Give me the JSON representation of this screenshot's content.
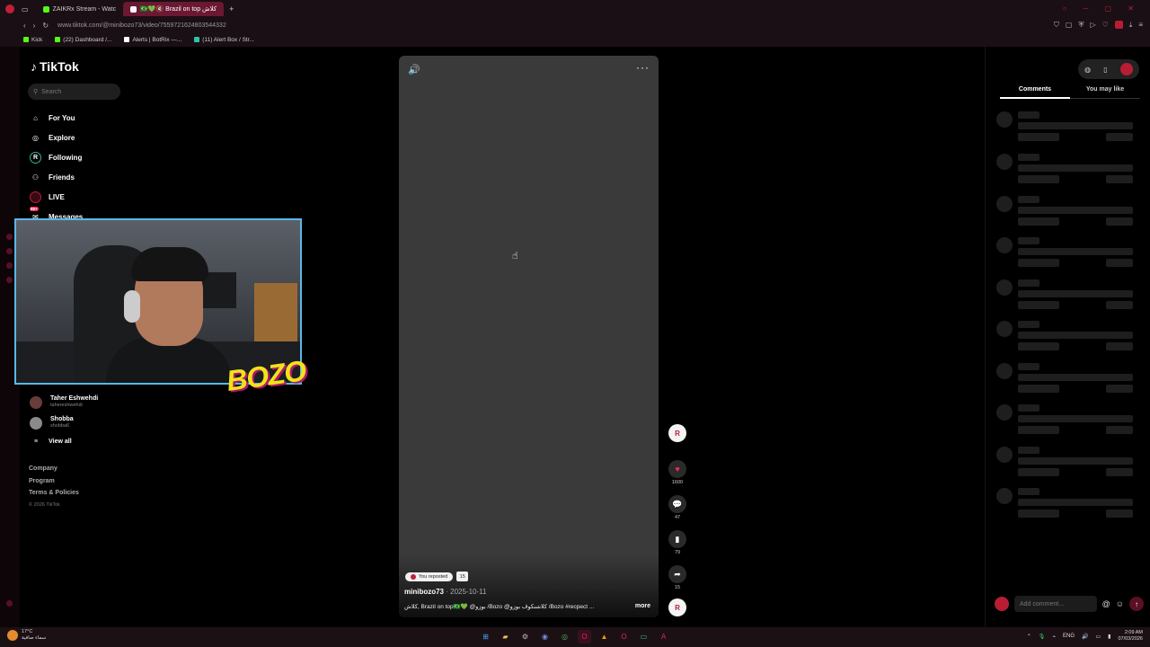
{
  "browser": {
    "tabs": [
      {
        "label": "ZAIKRx Stream - Watc",
        "color": "#53fc18"
      },
      {
        "label": "🇧🇷💚🔇 Brazil on top كلاش",
        "color": "#ffffff",
        "active": true
      }
    ],
    "new_tab": "+",
    "url": "www.tiktok.com/@minibozo73/video/7559721624803544332",
    "bookmarks": [
      {
        "label": "Kick",
        "color": "#53fc18"
      },
      {
        "label": "(22) Dashboard /...",
        "color": "#53fc18"
      },
      {
        "label": "Alerts | BotRix —...",
        "color": "#ffffff"
      },
      {
        "label": "(11) Alert Box / Str...",
        "color": "#31c3a2"
      }
    ]
  },
  "sidebar": {
    "logo": "TikTok",
    "search_placeholder": "Search",
    "nav": [
      {
        "label": "For You",
        "icon": "home-icon"
      },
      {
        "label": "Explore",
        "icon": "compass-icon"
      },
      {
        "label": "Following",
        "icon": "following-icon"
      },
      {
        "label": "Friends",
        "icon": "friends-icon"
      },
      {
        "label": "LIVE",
        "icon": "live-icon"
      },
      {
        "label": "Messages",
        "icon": "messages-icon",
        "badge": "99+"
      }
    ],
    "followed": [
      {
        "name": "Taher Eshwehdi",
        "handle": "tahereshwehdi"
      },
      {
        "name": "Shobba",
        "handle": "shobba6"
      }
    ],
    "view_all": "View all",
    "footer": [
      "Company",
      "Program",
      "Terms & Policies"
    ],
    "copyright": "© 2026 TikTok"
  },
  "overlay": {
    "brand_text": "BOZO"
  },
  "video": {
    "repost_label": "You reposted",
    "repost_count": "15",
    "author": "minibozo73",
    "date": "· 2025-10-11",
    "caption": "كلاش, Brazil on top🇧🇷💚 @بوزو /Bozo @كلاشنكوف بوزو /Bozo #recpect ...",
    "more": "more"
  },
  "actions": {
    "likes": "1600",
    "comments": "47",
    "saves": "79",
    "shares": "15"
  },
  "panel": {
    "tab_comments": "Comments",
    "tab_like": "You may like",
    "comment_placeholder": "Add comment..."
  },
  "taskbar": {
    "temp": "17°C",
    "weather": "سماء صافية",
    "lang": "ENG",
    "time": "2:09 AM",
    "date": "07/03/2026"
  }
}
